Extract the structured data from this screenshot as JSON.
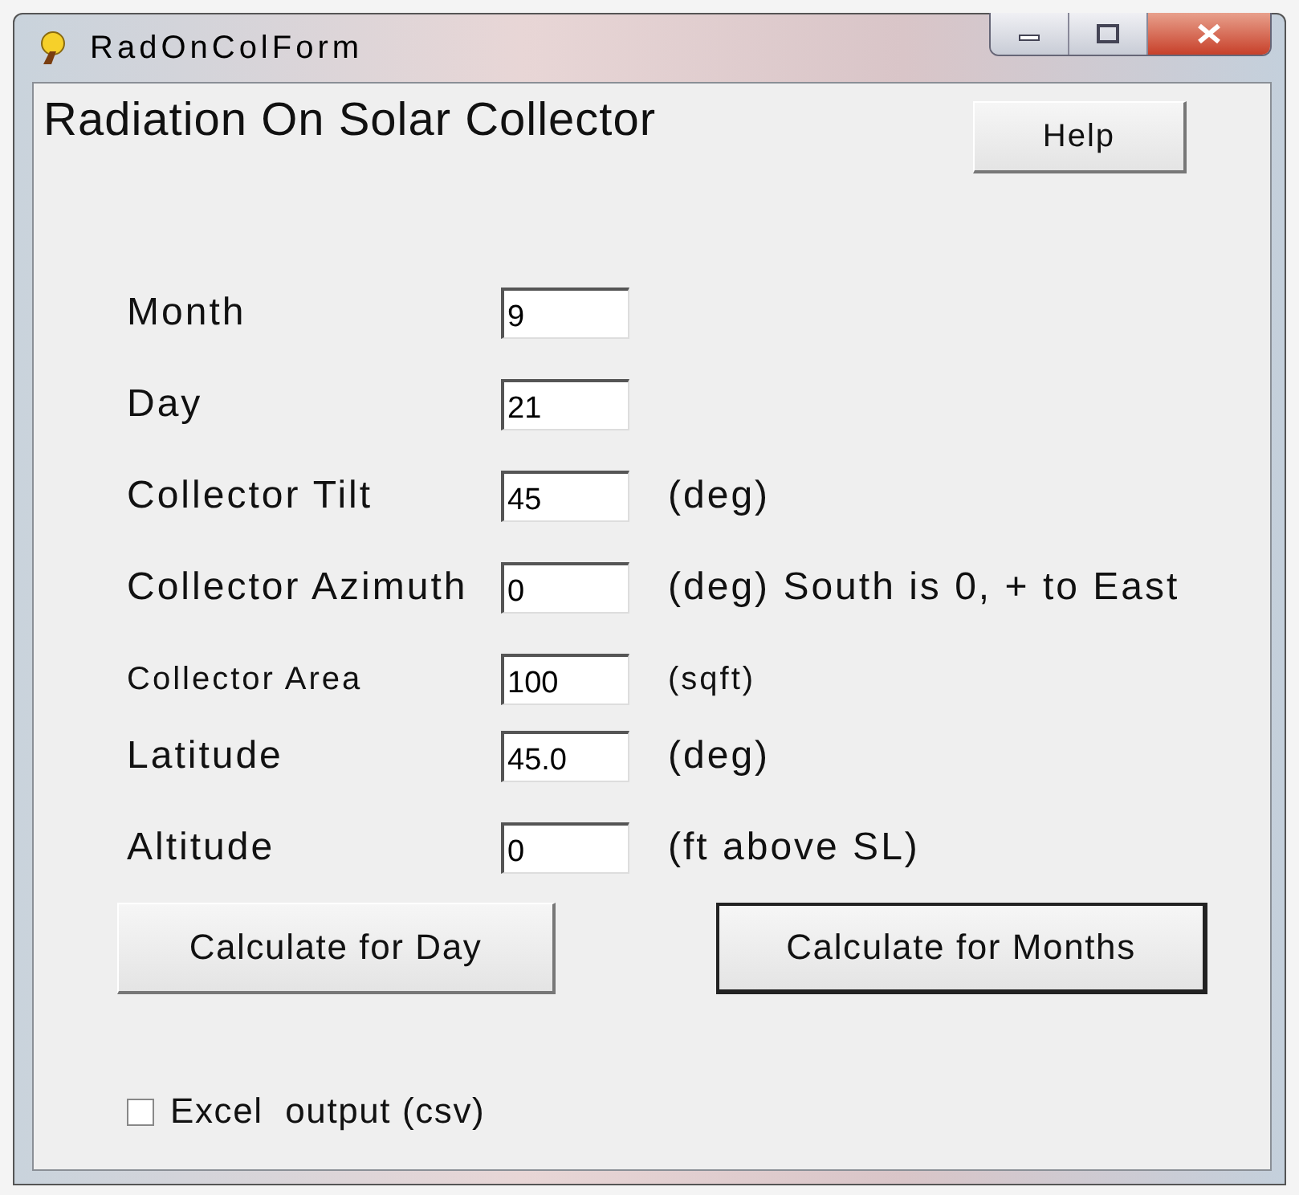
{
  "window": {
    "title": "RadOnColForm"
  },
  "heading": "Radiation On Solar Collector",
  "help_button": "Help",
  "fields": [
    {
      "label": "Month",
      "value": "9"
    },
    {
      "label": "Day",
      "value": "21"
    },
    {
      "label": "Collector Tilt",
      "value": "45",
      "unit": "(deg)"
    },
    {
      "label": "Collector Azimuth",
      "value": "0",
      "unit": "(deg) South is 0, + to East"
    },
    {
      "label": "Collector Area",
      "value": "100",
      "unit": "(sqft)"
    },
    {
      "label": "Latitude",
      "value": "45.0",
      "unit": "(deg)"
    },
    {
      "label": "Altitude",
      "value": "0",
      "unit": "(ft above SL)"
    }
  ],
  "buttons": [
    {
      "label": "Calculate for Day",
      "default": false
    },
    {
      "label": "Calculate for Months",
      "default": true
    }
  ],
  "excel_output": {
    "label": "Excel  output (csv)",
    "checked": false
  }
}
